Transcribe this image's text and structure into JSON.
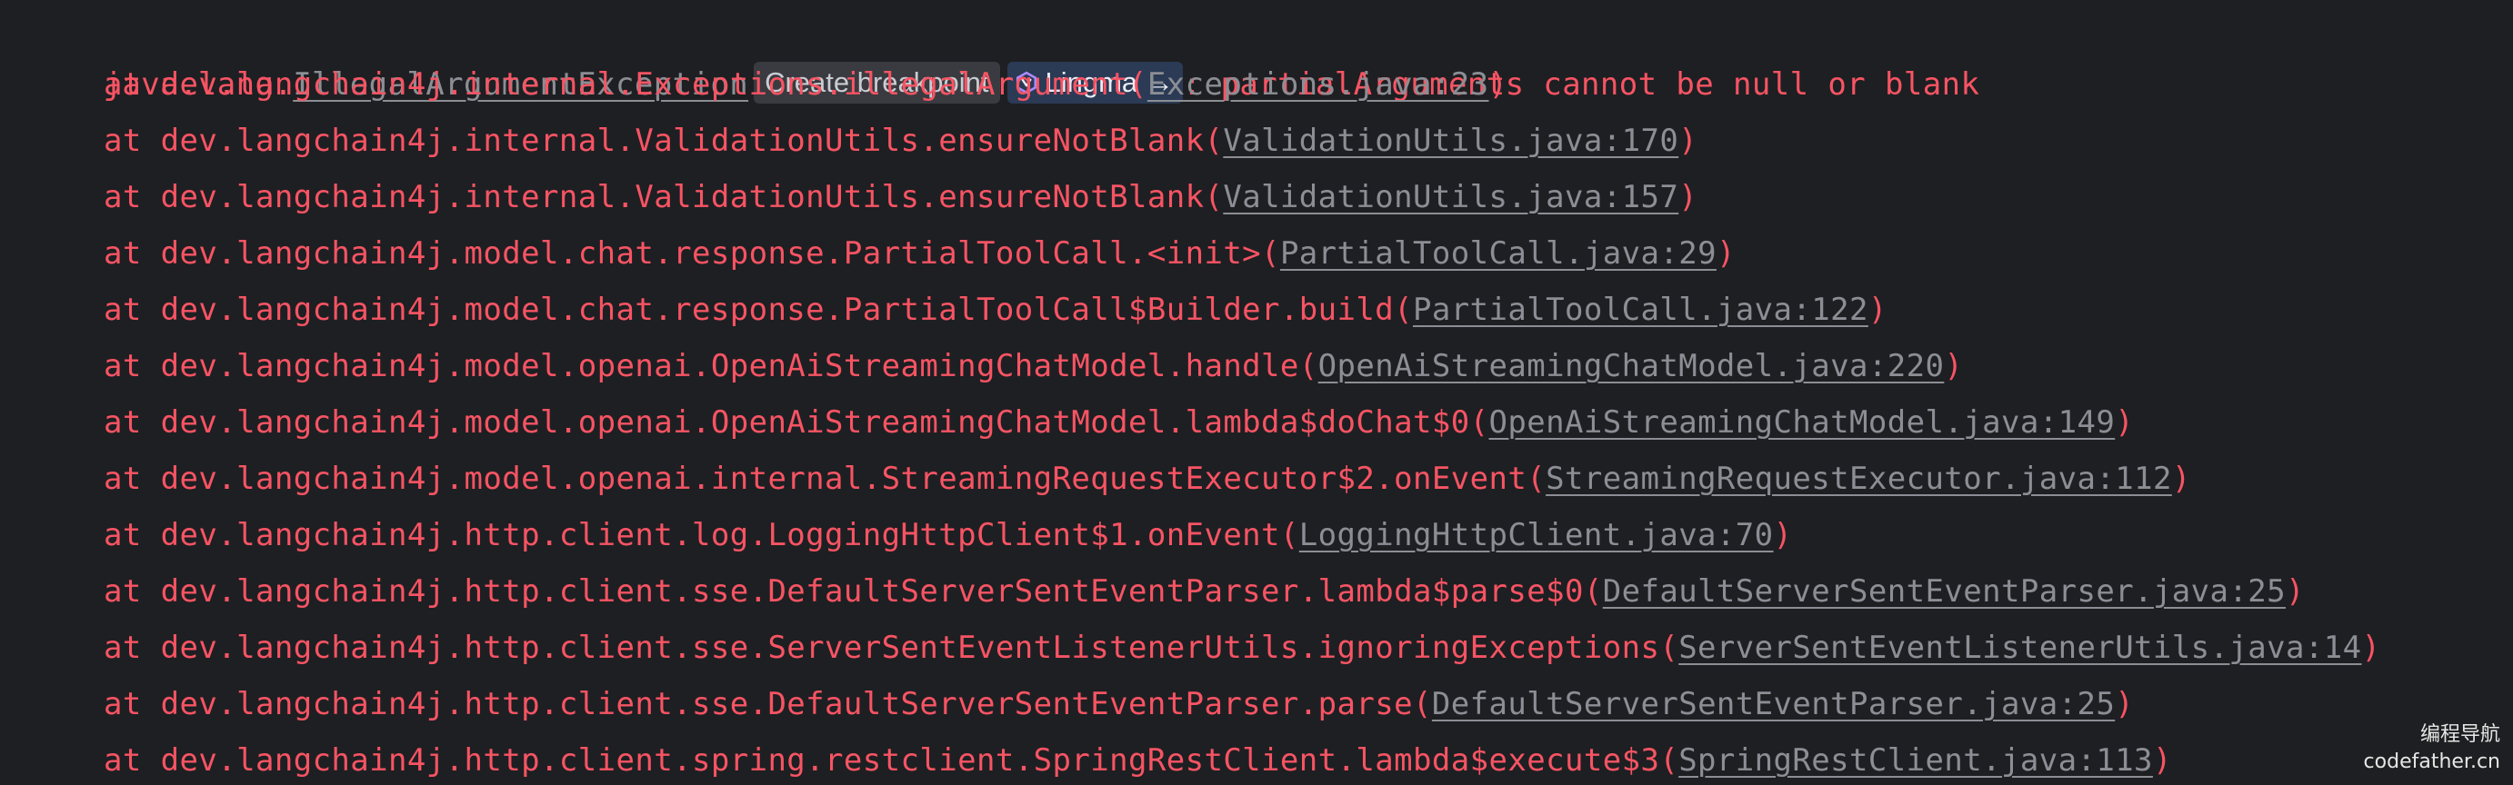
{
  "exception": {
    "prefix": "java.lang.",
    "class_name": "IllegalArgumentException",
    "breakpoint_label": "Create breakpoint",
    "lingma_label": "Lingma →",
    "message": ": partialArguments cannot be null or blank"
  },
  "frames": [
    {
      "text": "at dev.langchain4j.internal.Exceptions.illegalArgument(",
      "link": "Exceptions.java:23",
      "close": ")"
    },
    {
      "text": "at dev.langchain4j.internal.ValidationUtils.ensureNotBlank(",
      "link": "ValidationUtils.java:170",
      "close": ")"
    },
    {
      "text": "at dev.langchain4j.internal.ValidationUtils.ensureNotBlank(",
      "link": "ValidationUtils.java:157",
      "close": ")"
    },
    {
      "text": "at dev.langchain4j.model.chat.response.PartialToolCall.<init>(",
      "link": "PartialToolCall.java:29",
      "close": ")"
    },
    {
      "text": "at dev.langchain4j.model.chat.response.PartialToolCall$Builder.build(",
      "link": "PartialToolCall.java:122",
      "close": ")"
    },
    {
      "text": "at dev.langchain4j.model.openai.OpenAiStreamingChatModel.handle(",
      "link": "OpenAiStreamingChatModel.java:220",
      "close": ")"
    },
    {
      "text": "at dev.langchain4j.model.openai.OpenAiStreamingChatModel.lambda$doChat$0(",
      "link": "OpenAiStreamingChatModel.java:149",
      "close": ")"
    },
    {
      "text": "at dev.langchain4j.model.openai.internal.StreamingRequestExecutor$2.onEvent(",
      "link": "StreamingRequestExecutor.java:112",
      "close": ")"
    },
    {
      "text": "at dev.langchain4j.http.client.log.LoggingHttpClient$1.onEvent(",
      "link": "LoggingHttpClient.java:70",
      "close": ")"
    },
    {
      "text": "at dev.langchain4j.http.client.sse.DefaultServerSentEventParser.lambda$parse$0(",
      "link": "DefaultServerSentEventParser.java:25",
      "close": ")"
    },
    {
      "text": "at dev.langchain4j.http.client.sse.ServerSentEventListenerUtils.ignoringExceptions(",
      "link": "ServerSentEventListenerUtils.java:14",
      "close": ")"
    },
    {
      "text": "at dev.langchain4j.http.client.sse.DefaultServerSentEventParser.parse(",
      "link": "DefaultServerSentEventParser.java:25",
      "close": ")"
    },
    {
      "text": "at dev.langchain4j.http.client.spring.restclient.SpringRestClient.lambda$execute$3(",
      "link": "SpringRestClient.java:113",
      "close": ")"
    }
  ],
  "watermark": {
    "line1": "编程导航",
    "line2": "codefather.cn"
  },
  "colors": {
    "background": "#1e1f22",
    "error_text": "#f75464",
    "link_text": "#8b8e94",
    "inlay_bg": "#393b40",
    "lingma_bg": "#2b3a55"
  }
}
